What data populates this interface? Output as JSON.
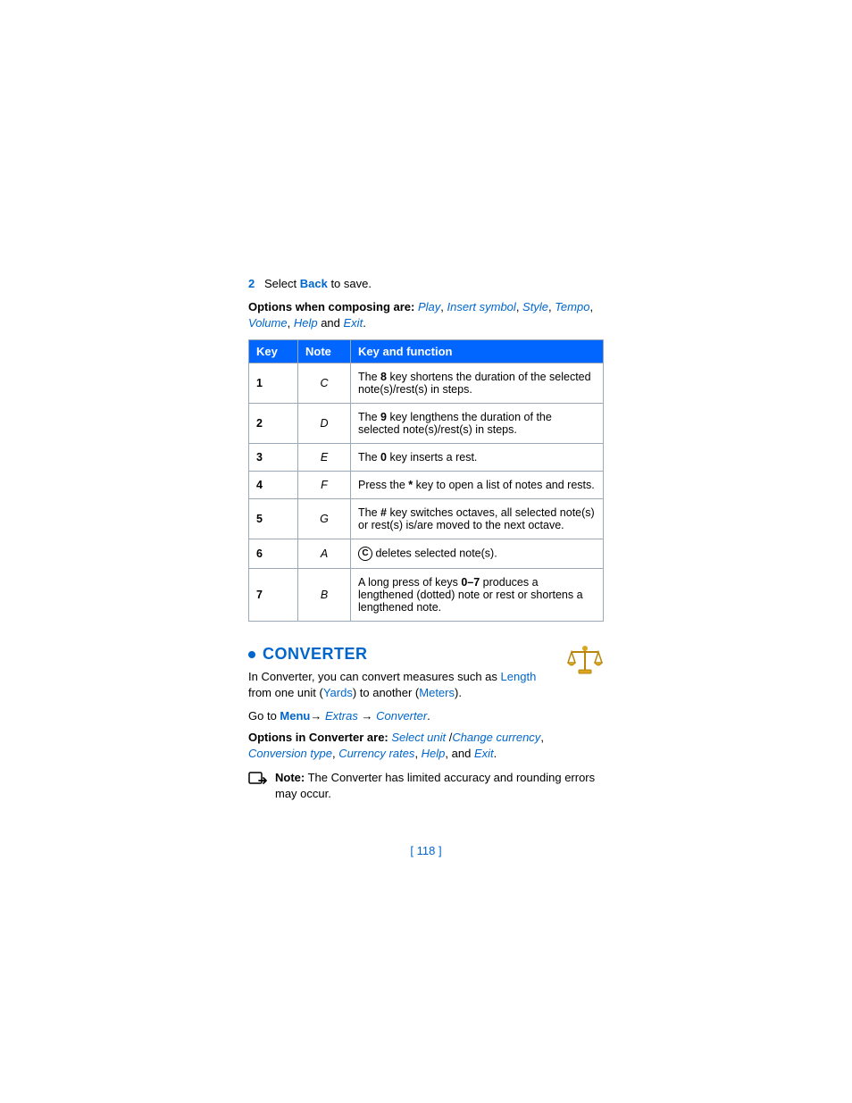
{
  "step": {
    "num": "2",
    "prefix": "Select ",
    "linkText": "Back",
    "suffix": " to save."
  },
  "composing": {
    "label": "Options when composing are: ",
    "opts": [
      "Play",
      "Insert symbol",
      "Style",
      "Tempo",
      "Volume",
      "Help",
      "Exit"
    ],
    "andWord": " and ",
    "sep": ", ",
    "end": "."
  },
  "table": {
    "headers": {
      "key": "Key",
      "note": "Note",
      "func": "Key and function"
    },
    "rows": [
      {
        "key": "1",
        "note": "C",
        "func_pre": "The ",
        "func_bold": "8",
        "func_post": " key shortens the duration of the selected note(s)/rest(s) in steps."
      },
      {
        "key": "2",
        "note": "D",
        "func_pre": "The ",
        "func_bold": "9",
        "func_post": " key lengthens the duration of the selected note(s)/rest(s) in steps."
      },
      {
        "key": "3",
        "note": "E",
        "func_pre": "The ",
        "func_bold": "0",
        "func_post": " key inserts a rest."
      },
      {
        "key": "4",
        "note": "F",
        "func_pre": "Press the ",
        "func_bold": "*",
        "func_post": " key to open a list of notes and rests."
      },
      {
        "key": "5",
        "note": "G",
        "func_pre": "The ",
        "func_bold": "#",
        "func_post": " key switches octaves, all selected note(s) or rest(s) is/are moved to the next octave."
      },
      {
        "key": "6",
        "note": "A",
        "badge": "C",
        "func_post": " deletes selected note(s)."
      },
      {
        "key": "7",
        "note": "B",
        "func_pre": "A long press of keys ",
        "func_bold": "0–7",
        "func_post": " produces a lengthened (dotted) note or rest or shortens a lengthened note."
      }
    ]
  },
  "converter": {
    "title": "CONVERTER",
    "desc_pre": "In Converter, you can convert measures such as ",
    "desc_link1": "Length",
    "desc_mid": " from one unit (",
    "desc_link2": "Yards",
    "desc_mid2": ") to another (",
    "desc_link3": "Meters",
    "desc_end": ").",
    "goto_pre": "Go to ",
    "menu": "Menu",
    "arrow": "→",
    "extras": "Extras",
    "conv": "Converter",
    "goto_end": ".",
    "opts_label": "Options in Converter are: ",
    "opts": [
      "Select unit",
      "Change currency",
      "Conversion type",
      "Currency rates",
      "Help",
      "Exit"
    ],
    "sep_slash": " /",
    "sep": ", ",
    "andWord": ", and ",
    "end": ".",
    "note_label": "Note:",
    "note_text": " The Converter has limited accuracy and rounding errors may occur."
  },
  "footer": "[ 118 ]"
}
